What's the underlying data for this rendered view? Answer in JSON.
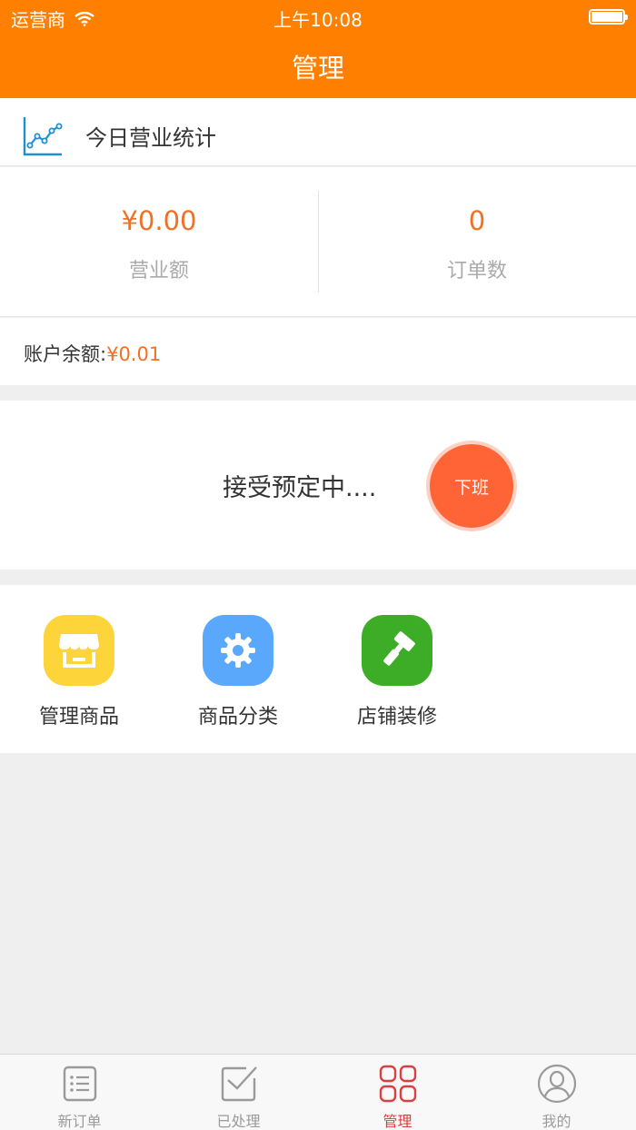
{
  "status_bar": {
    "carrier": "运营商",
    "time": "上午10:08"
  },
  "header": {
    "title": "管理",
    "background": "#ff7f00"
  },
  "stats": {
    "title": "今日营业统计",
    "icon": "line-chart-icon",
    "revenue": {
      "value": "¥0.00",
      "label": "营业额"
    },
    "orders": {
      "value": "0",
      "label": "订单数"
    }
  },
  "balance": {
    "label": "账户余额:",
    "value": "¥0.01"
  },
  "shop_status": {
    "text": "接受预定中....",
    "button_label": "下班",
    "button_color": "#ff6436"
  },
  "tools": [
    {
      "label": "管理商品",
      "icon": "store-icon",
      "color": "#fdd43a"
    },
    {
      "label": "商品分类",
      "icon": "gear-icon",
      "color": "#5aa8fb"
    },
    {
      "label": "店铺装修",
      "icon": "paint-roller-icon",
      "color": "#3dac26"
    }
  ],
  "tabbar": {
    "active_index": 2,
    "items": [
      {
        "label": "新订单",
        "icon": "order-list-icon"
      },
      {
        "label": "已处理",
        "icon": "processed-check-icon"
      },
      {
        "label": "管理",
        "icon": "grid-icon"
      },
      {
        "label": "我的",
        "icon": "profile-icon"
      }
    ]
  },
  "accent_color": "#f07024"
}
